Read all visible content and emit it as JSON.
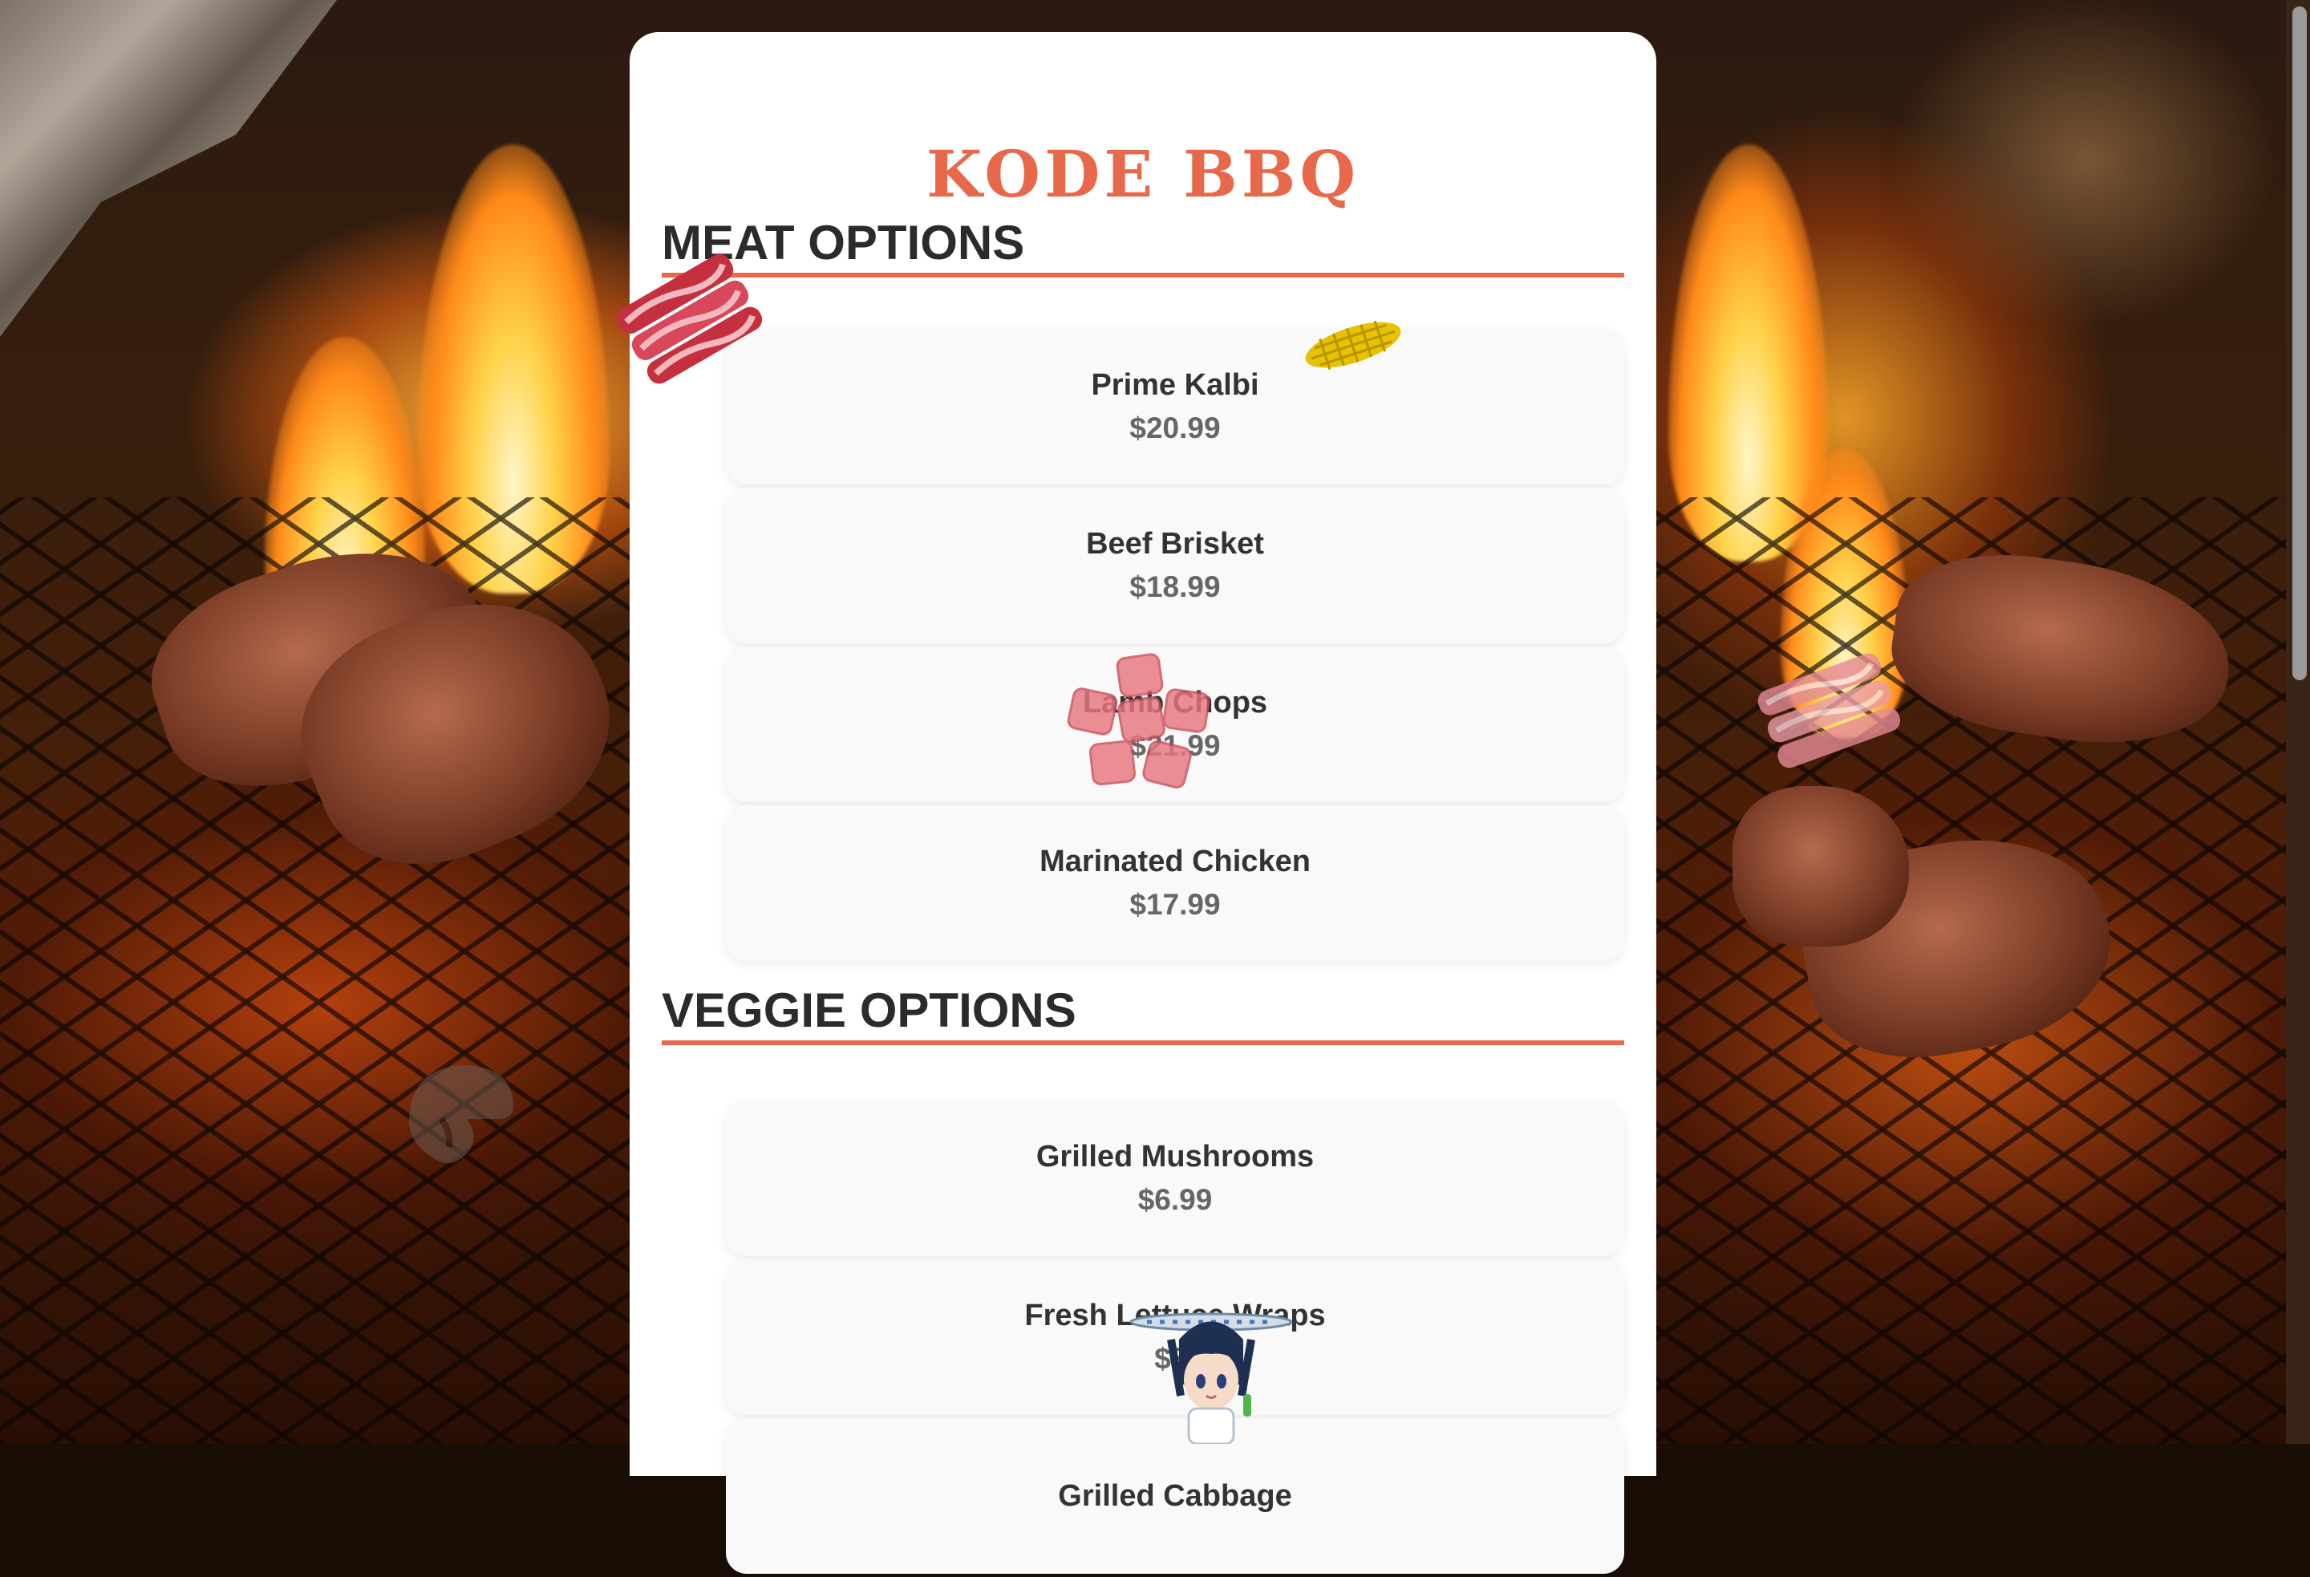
{
  "page": {
    "title": "KODE BBQ",
    "accent_color": "#e8684a"
  },
  "sections": [
    {
      "heading": "MEAT OPTIONS",
      "items": [
        {
          "name": "Prime Kalbi",
          "price": "$20.99"
        },
        {
          "name": "Beef Brisket",
          "price": "$18.99"
        },
        {
          "name": "Lamb Chops",
          "price": "$21.99"
        },
        {
          "name": "Marinated Chicken",
          "price": "$17.99"
        }
      ]
    },
    {
      "heading": "VEGGIE OPTIONS",
      "items": [
        {
          "name": "Grilled Mushrooms",
          "price": "$6.99"
        },
        {
          "name": "Fresh Lettuce Wraps",
          "price": "$3."
        },
        {
          "name": "Grilled Cabbage",
          "price": ""
        }
      ]
    }
  ],
  "decorations": {
    "icons": [
      "bacon-icon",
      "corn-icon",
      "meat-cubes-icon",
      "mushroom-icon",
      "chef-character-icon"
    ]
  }
}
